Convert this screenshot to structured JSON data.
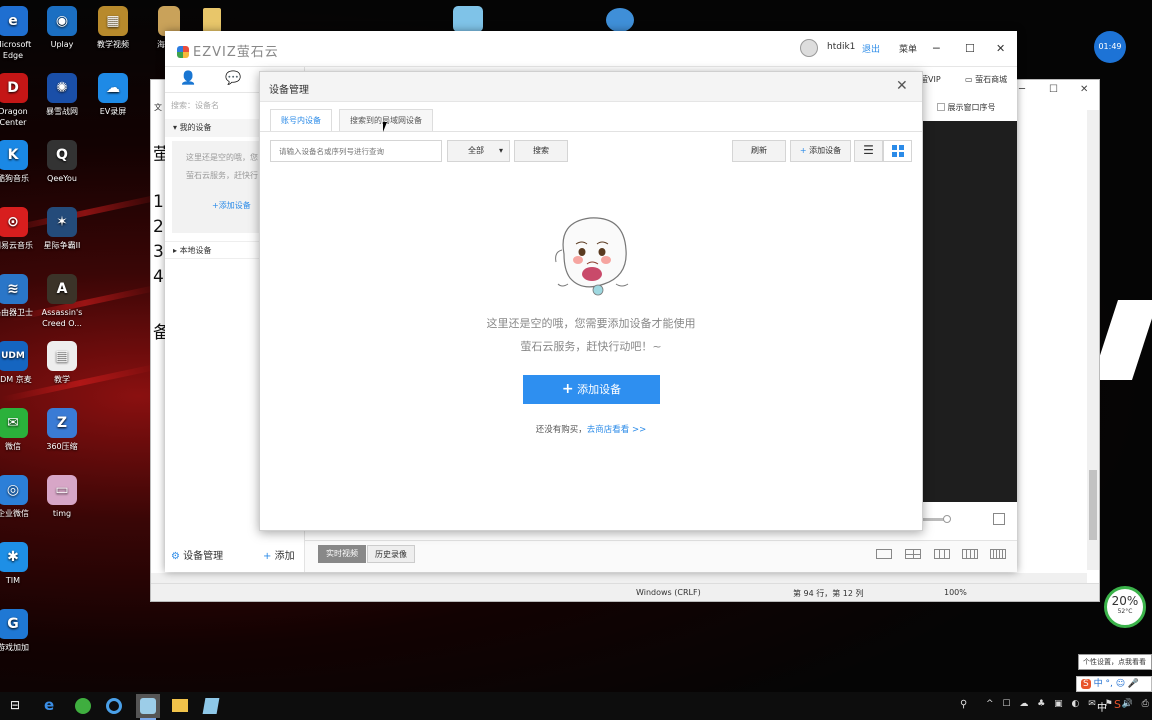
{
  "desktop": {
    "icons_left": [
      {
        "label": "Microsoft Edge",
        "glyph": "e",
        "color": "#1f6fd1"
      },
      {
        "label": "Dragon Center",
        "glyph": "D",
        "color": "#c41616"
      },
      {
        "label": "酷狗音乐",
        "glyph": "K",
        "color": "#1a88e5"
      },
      {
        "label": "网易云音乐",
        "glyph": "⊙",
        "color": "#d81e1e"
      },
      {
        "label": "路由器卫士",
        "glyph": "≋",
        "color": "#2a76c8"
      },
      {
        "label": "UDM 京麦",
        "glyph": "UDM",
        "color": "#1565c0"
      },
      {
        "label": "微信",
        "glyph": "✉",
        "color": "#2bb13b"
      },
      {
        "label": "企业微信",
        "glyph": "◎",
        "color": "#2c7fd8"
      },
      {
        "label": "TIM",
        "glyph": "✱",
        "color": "#1e8fe6"
      },
      {
        "label": "游戏加加",
        "glyph": "G",
        "color": "#1f78d4"
      }
    ],
    "icons_col2": [
      {
        "label": "Uplay",
        "glyph": "◉",
        "color": "#1b6fc2"
      },
      {
        "label": "暴雪战网",
        "glyph": "✺",
        "color": "#1a4fa8"
      },
      {
        "label": "QeeYou",
        "glyph": "Q",
        "color": "#333"
      },
      {
        "label": "星际争霸II",
        "glyph": "✶",
        "color": "#244b7a"
      },
      {
        "label": "Assassin's Creed O...",
        "glyph": "A",
        "color": "#3b3328"
      },
      {
        "label": "教学",
        "glyph": "▤",
        "color": "#eeeeee"
      },
      {
        "label": "360压缩",
        "glyph": "Z",
        "color": "#3a7bd5"
      },
      {
        "label": "timg",
        "glyph": "▭",
        "color": "#d7a6c7"
      }
    ],
    "icons_col3": [
      {
        "label": "教学视频",
        "glyph": "▦",
        "color": "#b88a2c"
      },
      {
        "label": "EV录屏",
        "glyph": "☁",
        "color": "#1e8ae6"
      }
    ],
    "icons_top": [
      {
        "label": "海康教",
        "glyph": "▮",
        "color": "#caa35a"
      }
    ],
    "clock_badge": "01:49",
    "gauge": {
      "percent": "20%",
      "temp": "52°C"
    },
    "ime_tooltip": "个性设置，点我看看"
  },
  "notepad": {
    "status_encoding": "Windows (CRLF)",
    "status_position": "第 94 行，第 12 列",
    "status_zoom": "100%",
    "left_text": [
      "萤",
      "1",
      "2",
      "3",
      "4",
      "备"
    ],
    "left_label": "文"
  },
  "ezviz": {
    "logo": "EZVIZ萤石云",
    "user": "htdik1",
    "logout": "退出",
    "menu": "菜单",
    "vip_label": "萤VIP",
    "mall": "萤石商城",
    "show_window_no": "展示窗口序号",
    "sidebar": {
      "search_placeholder": "搜索：设备名",
      "my_devices": "我的设备",
      "empty_text_1": "这里还是空的哦，您",
      "empty_text_2": "萤石云服务，赶快行",
      "add_device_link": "+添加设备",
      "local_devices": "本地设备",
      "device_manage": "设备管理",
      "add": "添加"
    },
    "bottom": {
      "live": "实时视频",
      "history": "历史录像"
    }
  },
  "dialog": {
    "title": "设备管理",
    "tabs": [
      "账号内设备",
      "搜索到的局域网设备"
    ],
    "search_placeholder": "请输入设备名或序列号进行查询",
    "filter_value": "全部",
    "search_btn": "搜索",
    "refresh_btn": "刷新",
    "add_device_btn": "添加设备",
    "empty_line_1": "这里还是空的哦，您需要添加设备才能使用",
    "empty_line_2": "萤石云服务，赶快行动吧！~",
    "primary_add": "添加设备",
    "no_purchase": "还没有购买，",
    "shop_link": "去商店看看 >>"
  },
  "taskbar": {
    "ime_cn": "中",
    "tray_text": "中"
  },
  "colors": {
    "accent": "#2b8be8",
    "primary_btn": "#2e8ff0"
  }
}
